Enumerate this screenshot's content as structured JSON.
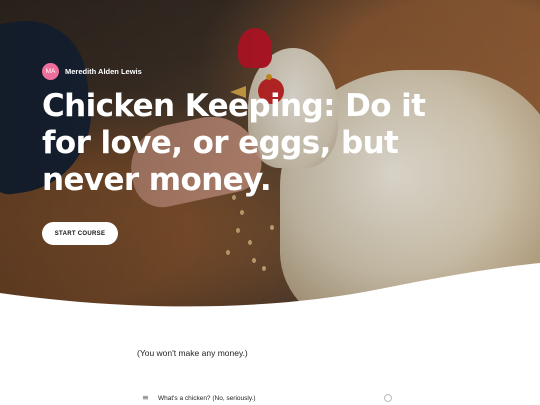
{
  "author": {
    "initials": "MA",
    "name": "Meredith Alden Lewis"
  },
  "course": {
    "title": "Chicken Keeping: Do it for love, or eggs, but never money.",
    "start_label": "START COURSE",
    "subtitle": "(You won't make any money.)"
  },
  "lessons": [
    {
      "label": "What's a chicken? (No, seriously.)",
      "icon": "list-icon"
    }
  ],
  "colors": {
    "avatar_bg": "#ee6f9c",
    "hero_text": "#ffffff",
    "button_bg": "#ffffff"
  }
}
